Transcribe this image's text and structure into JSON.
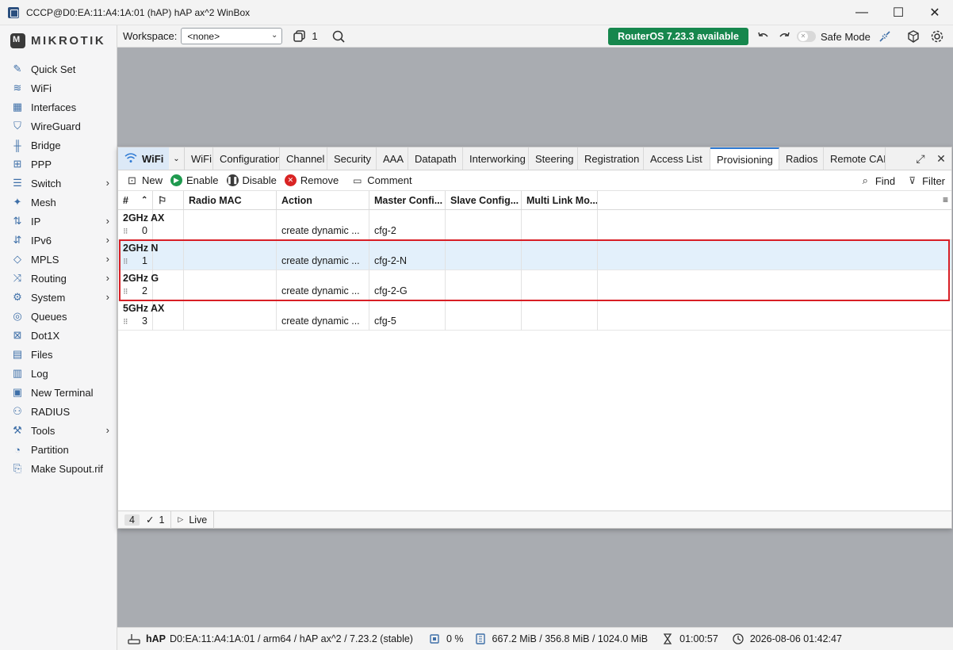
{
  "window": {
    "title": "CCCP@D0:EA:11:A4:1A:01 (hAP) hAP ax^2 WinBox",
    "controls": [
      "—",
      "☐",
      "✕"
    ]
  },
  "brand": {
    "logo_text": "MIKROTIK"
  },
  "sidebar": {
    "items": [
      {
        "label": "Quick Set",
        "icon": "wand-icon",
        "has_submenu": false
      },
      {
        "label": "WiFi",
        "icon": "wifi-icon",
        "has_submenu": false
      },
      {
        "label": "Interfaces",
        "icon": "interfaces-icon",
        "has_submenu": false
      },
      {
        "label": "WireGuard",
        "icon": "shield-icon",
        "has_submenu": false
      },
      {
        "label": "Bridge",
        "icon": "bridge-icon",
        "has_submenu": false
      },
      {
        "label": "PPP",
        "icon": "ppp-icon",
        "has_submenu": false
      },
      {
        "label": "Switch",
        "icon": "switch-icon",
        "has_submenu": true
      },
      {
        "label": "Mesh",
        "icon": "mesh-icon",
        "has_submenu": false
      },
      {
        "label": "IP",
        "icon": "ip-icon",
        "has_submenu": true
      },
      {
        "label": "IPv6",
        "icon": "ipv6-icon",
        "has_submenu": true
      },
      {
        "label": "MPLS",
        "icon": "tag-icon",
        "has_submenu": true
      },
      {
        "label": "Routing",
        "icon": "routing-icon",
        "has_submenu": true
      },
      {
        "label": "System",
        "icon": "gear-icon",
        "has_submenu": true
      },
      {
        "label": "Queues",
        "icon": "queues-icon",
        "has_submenu": false
      },
      {
        "label": "Dot1X",
        "icon": "dot1x-icon",
        "has_submenu": false
      },
      {
        "label": "Files",
        "icon": "files-icon",
        "has_submenu": false
      },
      {
        "label": "Log",
        "icon": "log-icon",
        "has_submenu": false
      },
      {
        "label": "New Terminal",
        "icon": "terminal-icon",
        "has_submenu": false
      },
      {
        "label": "RADIUS",
        "icon": "radius-icon",
        "has_submenu": false
      },
      {
        "label": "Tools",
        "icon": "tools-icon",
        "has_submenu": true
      },
      {
        "label": "Partition",
        "icon": "partition-icon",
        "has_submenu": false
      },
      {
        "label": "Make Supout.rif",
        "icon": "supout-icon",
        "has_submenu": false
      }
    ]
  },
  "toolbar": {
    "workspace_label": "Workspace:",
    "workspace_value": "<none>",
    "windows_count": "1",
    "update_badge": "RouterOS 7.23.3 available",
    "safe_mode_label": "Safe Mode"
  },
  "wifi_window": {
    "title": "WiFi",
    "tabs": [
      "WiFi",
      "Configuration",
      "Channel",
      "Security",
      "AAA",
      "Datapath",
      "Interworking",
      "Steering",
      "Registration",
      "Access List",
      "Provisioning",
      "Radios",
      "Remote CAP"
    ],
    "active_tab": "Provisioning",
    "actions": {
      "new": "New",
      "enable": "Enable",
      "disable": "Disable",
      "remove": "Remove",
      "comment": "Comment",
      "find": "Find",
      "filter": "Filter"
    },
    "columns": [
      "#",
      "",
      "Radio MAC",
      "Action",
      "Master Confi...",
      "Slave Config...",
      "Multi Link Mo..."
    ],
    "rows": [
      {
        "group": "2GHz AX",
        "num": "0",
        "radio_mac": "",
        "action": "create dynamic ...",
        "master": "cfg-2",
        "slave": "",
        "multi": "",
        "selected": false
      },
      {
        "group": "2GHz N",
        "num": "1",
        "radio_mac": "",
        "action": "create dynamic ...",
        "master": "cfg-2-N",
        "slave": "",
        "multi": "",
        "selected": true
      },
      {
        "group": "2GHz G",
        "num": "2",
        "radio_mac": "",
        "action": "create dynamic ...",
        "master": "cfg-2-G",
        "slave": "",
        "multi": "",
        "selected": false
      },
      {
        "group": "5GHz AX",
        "num": "3",
        "radio_mac": "",
        "action": "create dynamic ...",
        "master": "cfg-5",
        "slave": "",
        "multi": "",
        "selected": false
      }
    ],
    "status": {
      "total": "4",
      "selected": "1",
      "live_label": "Live"
    }
  },
  "statusbar": {
    "device": "hAP",
    "device_info": "D0:EA:11:A4:1A:01 / arm64 / hAP ax^2 / 7.23.2 (stable)",
    "cpu": "0 %",
    "memory": "667.2 MiB / 356.8 MiB / 1024.0 MiB",
    "uptime": "01:00:57",
    "datetime": "2026-08-06 01:42:47"
  },
  "colors": {
    "accent": "#2f7ad3",
    "update_badge": "#16874d",
    "highlight": "#d81f26",
    "selected_row": "#e3f0fb"
  }
}
